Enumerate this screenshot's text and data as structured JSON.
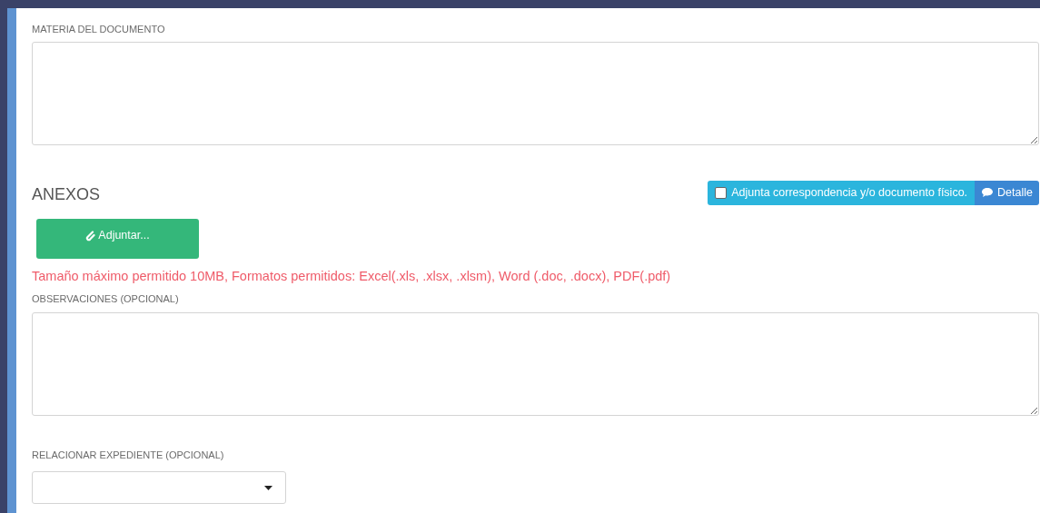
{
  "materia": {
    "label": "MATERIA DEL DOCUMENTO"
  },
  "anexos": {
    "title": "ANEXOS",
    "physical_toggle": {
      "label": "Adjunta correspondencia y/o documento físico.",
      "checked": false
    },
    "detail_button": "Detalle",
    "attach_button": "Adjuntar...",
    "notice": "Tamaño máximo permitido 10MB, Formatos permitidos: Excel(.xls, .xlsx, .xlsm), Word (.doc, .docx), PDF(.pdf)"
  },
  "observaciones": {
    "label": "OBSERVACIONES (OPCIONAL)"
  },
  "expediente": {
    "label": "RELACIONAR EXPEDIENTE (OPCIONAL)"
  }
}
